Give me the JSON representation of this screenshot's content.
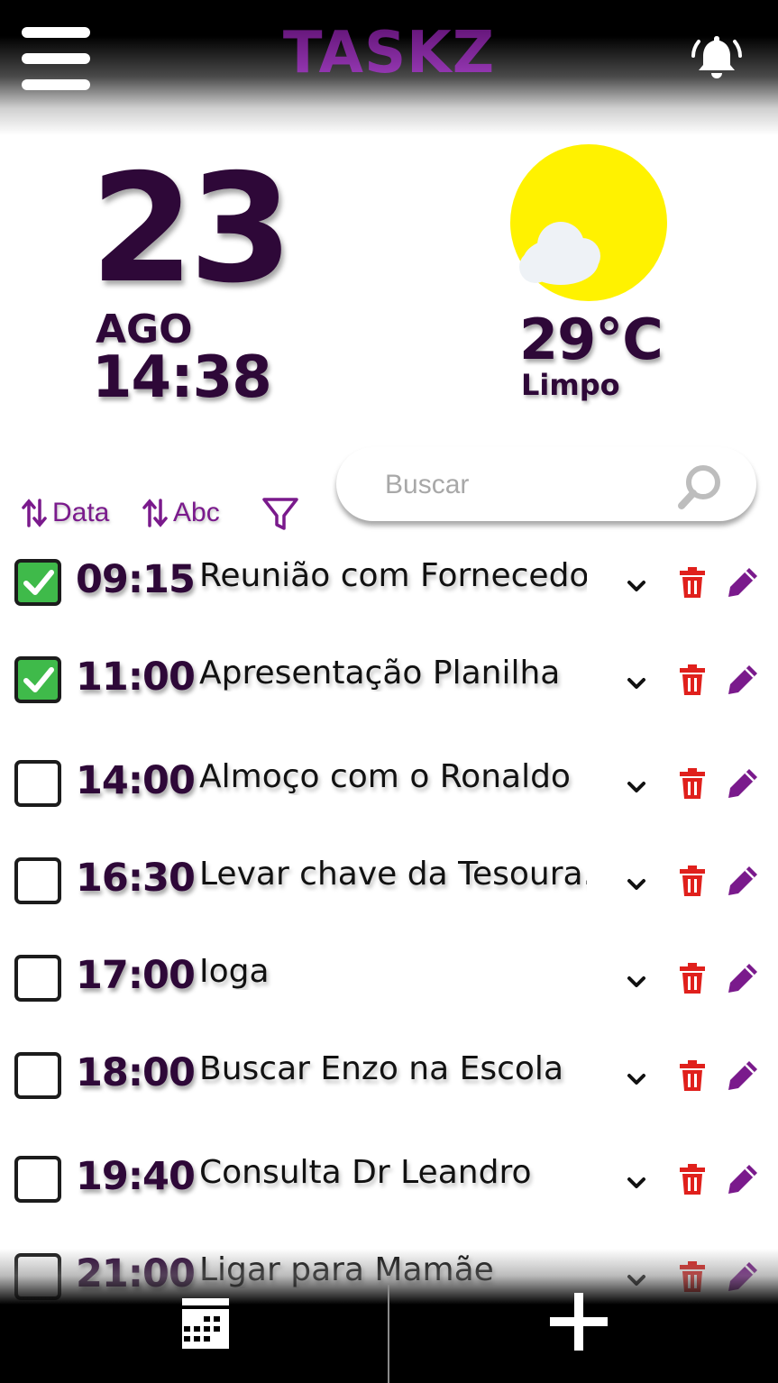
{
  "header": {
    "title": "TASKZ",
    "menu_icon": "hamburger-menu-icon",
    "notification_icon": "bell-icon"
  },
  "date": {
    "day": "23",
    "month": "AGO",
    "time": "14:38"
  },
  "weather": {
    "icon": "sun-with-cloud-icon",
    "temperature": "29°C",
    "condition": "Limpo",
    "sun_color": "#fff200"
  },
  "toolbar": {
    "sort_date_label": "Data",
    "sort_abc_label": "Abc",
    "filter_icon": "funnel-icon",
    "search_placeholder": "Buscar",
    "search_value": ""
  },
  "tasks": [
    {
      "time": "09:15",
      "title": "Reunião com Fornecedor",
      "done": true
    },
    {
      "time": "11:00",
      "title": "Apresentação Planilha",
      "done": true
    },
    {
      "time": "14:00",
      "title": "Almoço com o Ronaldo",
      "done": false
    },
    {
      "time": "16:30",
      "title": "Levar chave da Tesoura..",
      "done": false
    },
    {
      "time": "17:00",
      "title": "Ioga",
      "done": false
    },
    {
      "time": "18:00",
      "title": "Buscar Enzo na Escola",
      "done": false
    },
    {
      "time": "19:40",
      "title": "Consulta Dr Leandro",
      "done": false
    },
    {
      "time": "21:00",
      "title": "Ligar para Mamãe",
      "done": false
    }
  ],
  "bottom_bar": {
    "calendar_icon": "calendar-icon",
    "add_icon": "plus-icon"
  },
  "colors": {
    "brand_purple": "#7a1a8c",
    "dark_purple": "#2e0838",
    "check_green": "#3fba4a",
    "delete_red": "#e0201c"
  }
}
